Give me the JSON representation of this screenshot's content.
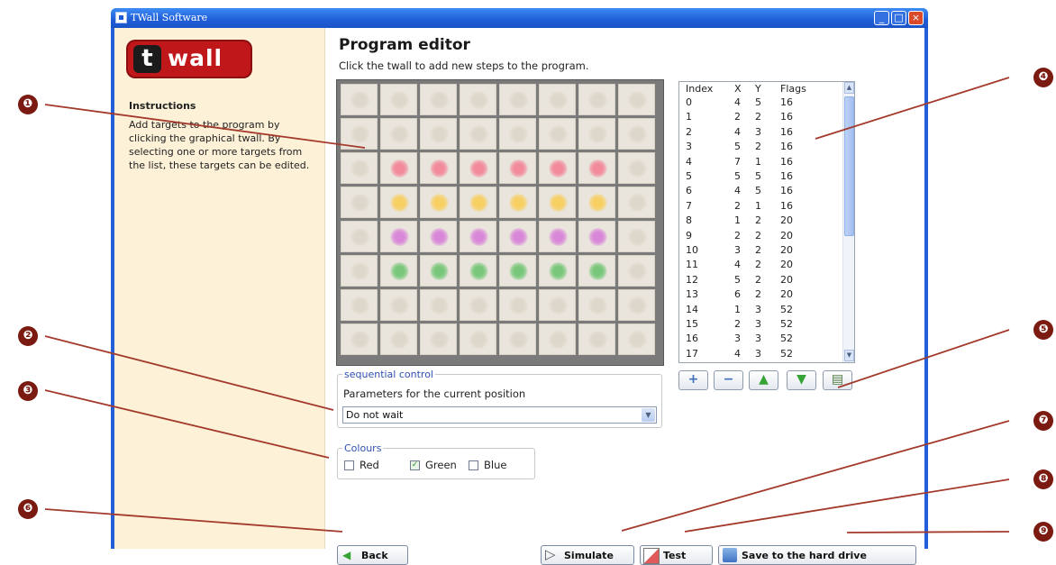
{
  "window": {
    "title": "TWall Software"
  },
  "sidebar": {
    "logo": {
      "mark": "t",
      "word": "wall"
    },
    "instructions_heading": "Instructions",
    "instructions_text": "Add targets to the program by clicking the graphical twall. By selecting one or more targets from the list, these targets can be edited."
  },
  "editor": {
    "heading": "Program editor",
    "subheading": "Click the twall to add new steps to the program."
  },
  "grid": {
    "rows": 8,
    "cols": 8,
    "row_colors": [
      "",
      "",
      "#f28a9c",
      "#f7cf63",
      "#d987d8",
      "#79c77b",
      "",
      ""
    ],
    "base_cell_color": "#eae5dc"
  },
  "targets_list": {
    "columns": [
      "Index",
      "X",
      "Y",
      "Flags"
    ],
    "rows": [
      [
        "0",
        "4",
        "5",
        "16"
      ],
      [
        "1",
        "2",
        "2",
        "16"
      ],
      [
        "2",
        "4",
        "3",
        "16"
      ],
      [
        "3",
        "5",
        "2",
        "16"
      ],
      [
        "4",
        "7",
        "1",
        "16"
      ],
      [
        "5",
        "5",
        "5",
        "16"
      ],
      [
        "6",
        "4",
        "5",
        "16"
      ],
      [
        "7",
        "2",
        "1",
        "16"
      ],
      [
        "8",
        "1",
        "2",
        "20"
      ],
      [
        "9",
        "2",
        "2",
        "20"
      ],
      [
        "10",
        "3",
        "2",
        "20"
      ],
      [
        "11",
        "4",
        "2",
        "20"
      ],
      [
        "12",
        "5",
        "2",
        "20"
      ],
      [
        "13",
        "6",
        "2",
        "20"
      ],
      [
        "14",
        "1",
        "3",
        "52"
      ],
      [
        "15",
        "2",
        "3",
        "52"
      ],
      [
        "16",
        "3",
        "3",
        "52"
      ],
      [
        "17",
        "4",
        "3",
        "52"
      ]
    ],
    "buttons": [
      "add-icon",
      "remove-icon",
      "move-up-icon",
      "move-down-icon",
      "delete-icon"
    ]
  },
  "sequential_control": {
    "legend": "sequential control",
    "label": "Parameters for the current position",
    "selected": "Do not wait"
  },
  "colours": {
    "legend": "Colours",
    "options": [
      {
        "label": "Red",
        "checked": false
      },
      {
        "label": "Green",
        "checked": true
      },
      {
        "label": "Blue",
        "checked": false
      }
    ]
  },
  "actions": {
    "back": "Back",
    "simulate": "Simulate",
    "test": "Test",
    "save": "Save to the hard drive"
  },
  "callouts": [
    "❶",
    "❷",
    "❸",
    "❹",
    "❺",
    "❻",
    "❼",
    "❽",
    "❾"
  ],
  "colors": {
    "window_frame": "#245edb",
    "sidebar_bg": "#fdf1d8",
    "callout": "#7a1a10"
  }
}
